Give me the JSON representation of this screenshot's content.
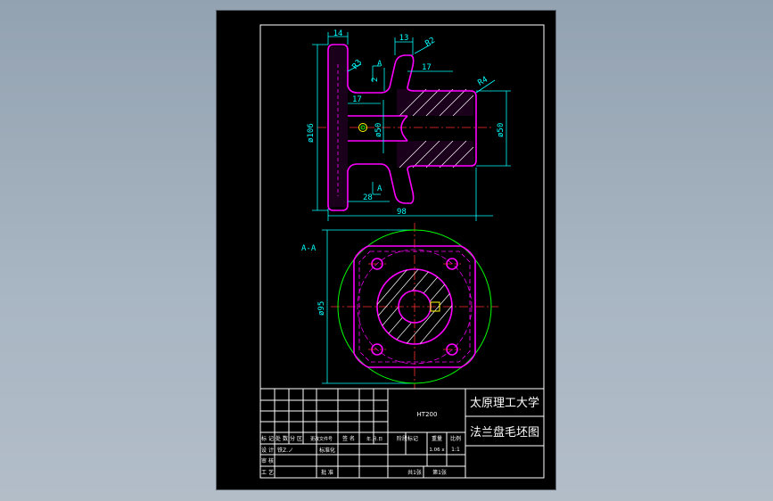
{
  "drawing": {
    "dimensions": {
      "d14": "14",
      "d13": "13",
      "r2": "R2",
      "r3": "R3",
      "a_top": "A",
      "d2": "2",
      "d17a": "17",
      "d17b": "17",
      "r4": "R4",
      "d106": "ø106",
      "d50a": "ø50",
      "d50b": "ø50",
      "a_bottom": "A",
      "d28": "28",
      "d98": "98",
      "d95": "ø95"
    },
    "section_label": "A-A"
  },
  "title_block": {
    "university": "太原理工大学",
    "drawing_title": "法兰盘毛坯图",
    "material": "HT200",
    "rev_row": [
      "标 记",
      "处 数",
      "分 区",
      "更改文件号",
      "签 名",
      "年.月.日"
    ],
    "design_row": [
      "设 计",
      "铁Z.ノ",
      "标准化"
    ],
    "review_label": "审 核",
    "process_label": "工 艺",
    "approve_label": "批 准",
    "stage_label": "阶段标记",
    "weight_label": "重量",
    "scale_label": "比例",
    "weight_value": "1.06 x",
    "scale_value": "1:1",
    "sheets_total": "共1张",
    "sheet_no": "第1张"
  }
}
